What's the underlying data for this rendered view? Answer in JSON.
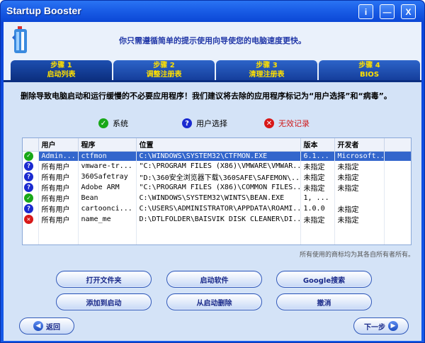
{
  "window": {
    "title": "Startup Booster"
  },
  "titlebar_buttons": {
    "info": "i",
    "minimize": "—",
    "close": "X"
  },
  "header": {
    "text": "你只需遵循简单的提示使用向导使您的电脑速度更快。"
  },
  "tabs": [
    {
      "line1": "步骤 1",
      "line2": "启动列表",
      "active": true
    },
    {
      "line1": "步骤 2",
      "line2": "调整注册表",
      "active": false
    },
    {
      "line1": "步骤 3",
      "line2": "清理注册表",
      "active": false
    },
    {
      "line1": "步骤 4",
      "line2": "BIOS",
      "active": false
    }
  ],
  "description": "删除导致电脑启动和运行缓慢的不必要应用程序！我们建议将去除的应用程序标记为“用户选择”和“病毒”。",
  "legend": {
    "system": "系统",
    "user_choice": "用户选择",
    "invalid": "无效记录"
  },
  "table": {
    "columns": [
      "用户",
      "程序",
      "位置",
      "版本",
      "开发者"
    ],
    "rows": [
      {
        "icon": "ok",
        "user": "Admin...",
        "program": "ctfmon",
        "location": "C:\\WINDOWS\\SYSTEM32\\CTFMON.EXE",
        "version": "6.1...",
        "developer": "Microsoft...",
        "selected": true
      },
      {
        "icon": "q",
        "user": "所有用户",
        "program": "vmware-tr...",
        "location": "\"C:\\PROGRAM FILES (X86)\\VMWARE\\VMWAR...",
        "version": "未指定",
        "developer": "未指定",
        "selected": false
      },
      {
        "icon": "q",
        "user": "所有用户",
        "program": "360Safetray",
        "location": "\"D:\\360安全浏览器下载\\360SAFE\\SAFEMON\\...",
        "version": "未指定",
        "developer": "未指定",
        "selected": false
      },
      {
        "icon": "q",
        "user": "所有用户",
        "program": "Adobe ARM",
        "location": "\"C:\\PROGRAM FILES (X86)\\COMMON FILES...",
        "version": "未指定",
        "developer": "未指定",
        "selected": false
      },
      {
        "icon": "ok",
        "user": "所有用户",
        "program": "Bean",
        "location": "C:\\WINDOWS\\SYSTEM32\\WINTS\\BEAN.EXE",
        "version": "1, ...",
        "developer": "",
        "selected": false
      },
      {
        "icon": "q",
        "user": "所有用户",
        "program": "cartoonci...",
        "location": "C:\\USERS\\ADMINISTRATOR\\APPDATA\\ROAMI...",
        "version": "1.0.0",
        "developer": "未指定",
        "selected": false
      },
      {
        "icon": "x",
        "user": "所有用户",
        "program": "name_me",
        "location": "D:\\DTLFOLDER\\BAISVIK DISK CLEANER\\DI...",
        "version": "未指定",
        "developer": "未指定",
        "selected": false
      }
    ]
  },
  "trademark": "所有使用的商标均为其各自所有者所有。",
  "buttons": {
    "open_folder": "打开文件夹",
    "launch_software": "启动软件",
    "google_search": "Google搜索",
    "add_startup": "添加到启动",
    "remove_startup": "从启动删除",
    "undo": "撤消"
  },
  "nav": {
    "back": "返回",
    "next": "下一步"
  },
  "colors": {
    "title_bar": "#1a5de6",
    "selected_row": "#3366cc",
    "tab_text": "#ffe000",
    "header_text": "#2238a8"
  }
}
